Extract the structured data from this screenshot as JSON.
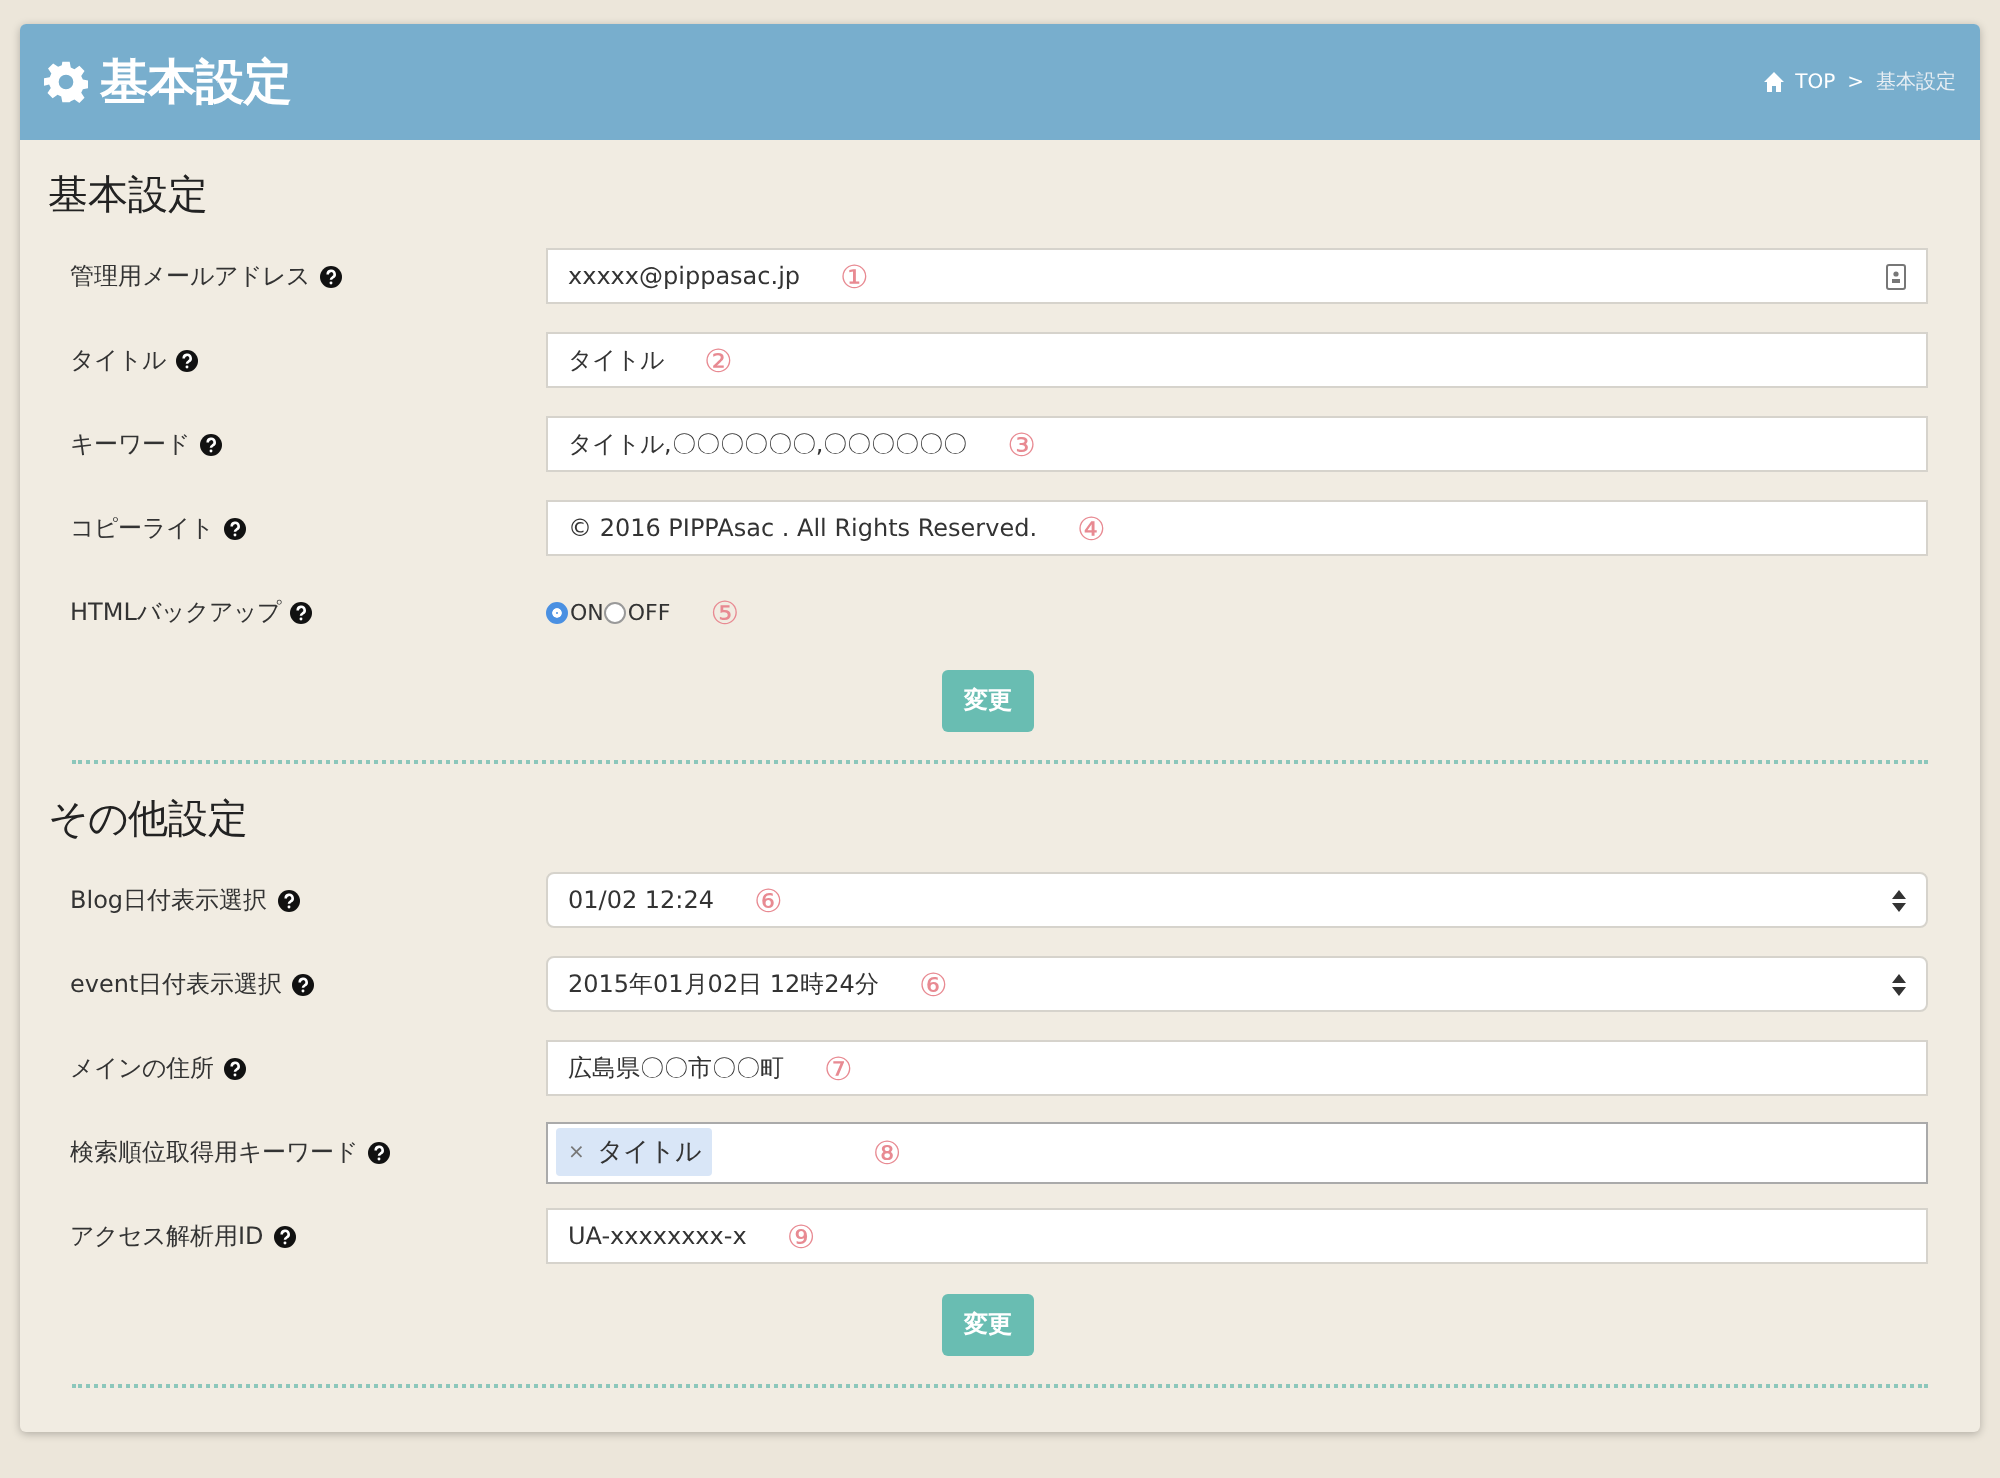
{
  "header": {
    "title": "基本設定",
    "breadcrumb": [
      {
        "label": "TOP"
      },
      {
        "label": "基本設定"
      }
    ],
    "separator": ">"
  },
  "sections": [
    {
      "heading": "基本設定",
      "rows": [
        {
          "label": "管理用メールアドレス",
          "kind": "email",
          "value": "xxxxx@pippasac.jp",
          "annotation": "①"
        },
        {
          "label": "タイトル",
          "kind": "text",
          "value": "タイトル",
          "annotation": "②"
        },
        {
          "label": "キーワード",
          "kind": "text",
          "value": "タイトル,〇〇〇〇〇〇,〇〇〇〇〇〇",
          "annotation": "③"
        },
        {
          "label": "コピーライト",
          "kind": "text",
          "value": "© 2016 PIPPAsac . All Rights Reserved.",
          "annotation": "④"
        },
        {
          "label": "HTMLバックアップ",
          "kind": "radio",
          "options": [
            {
              "label": "ON",
              "selected": true
            },
            {
              "label": "OFF",
              "selected": false
            }
          ],
          "annotation": "⑤"
        }
      ],
      "button": "変更"
    },
    {
      "heading": "その他設定",
      "rows": [
        {
          "label": "Blog日付表示選択",
          "kind": "select",
          "value": "01/02 12:24",
          "annotation": "⑥"
        },
        {
          "label": "event日付表示選択",
          "kind": "select",
          "value": "2015年01月02日 12時24分",
          "annotation": "⑥"
        },
        {
          "label": "メインの住所",
          "kind": "text",
          "value": "広島県〇〇市〇〇町",
          "annotation": "⑦"
        },
        {
          "label": "検索順位取得用キーワード",
          "kind": "tags",
          "tags": [
            {
              "label": "タイトル",
              "remove": "×"
            }
          ],
          "annotation": "⑧"
        },
        {
          "label": "アクセス解析用ID",
          "kind": "text",
          "value": "UA-xxxxxxxx-x",
          "annotation": "⑨"
        }
      ],
      "button": "変更"
    }
  ]
}
